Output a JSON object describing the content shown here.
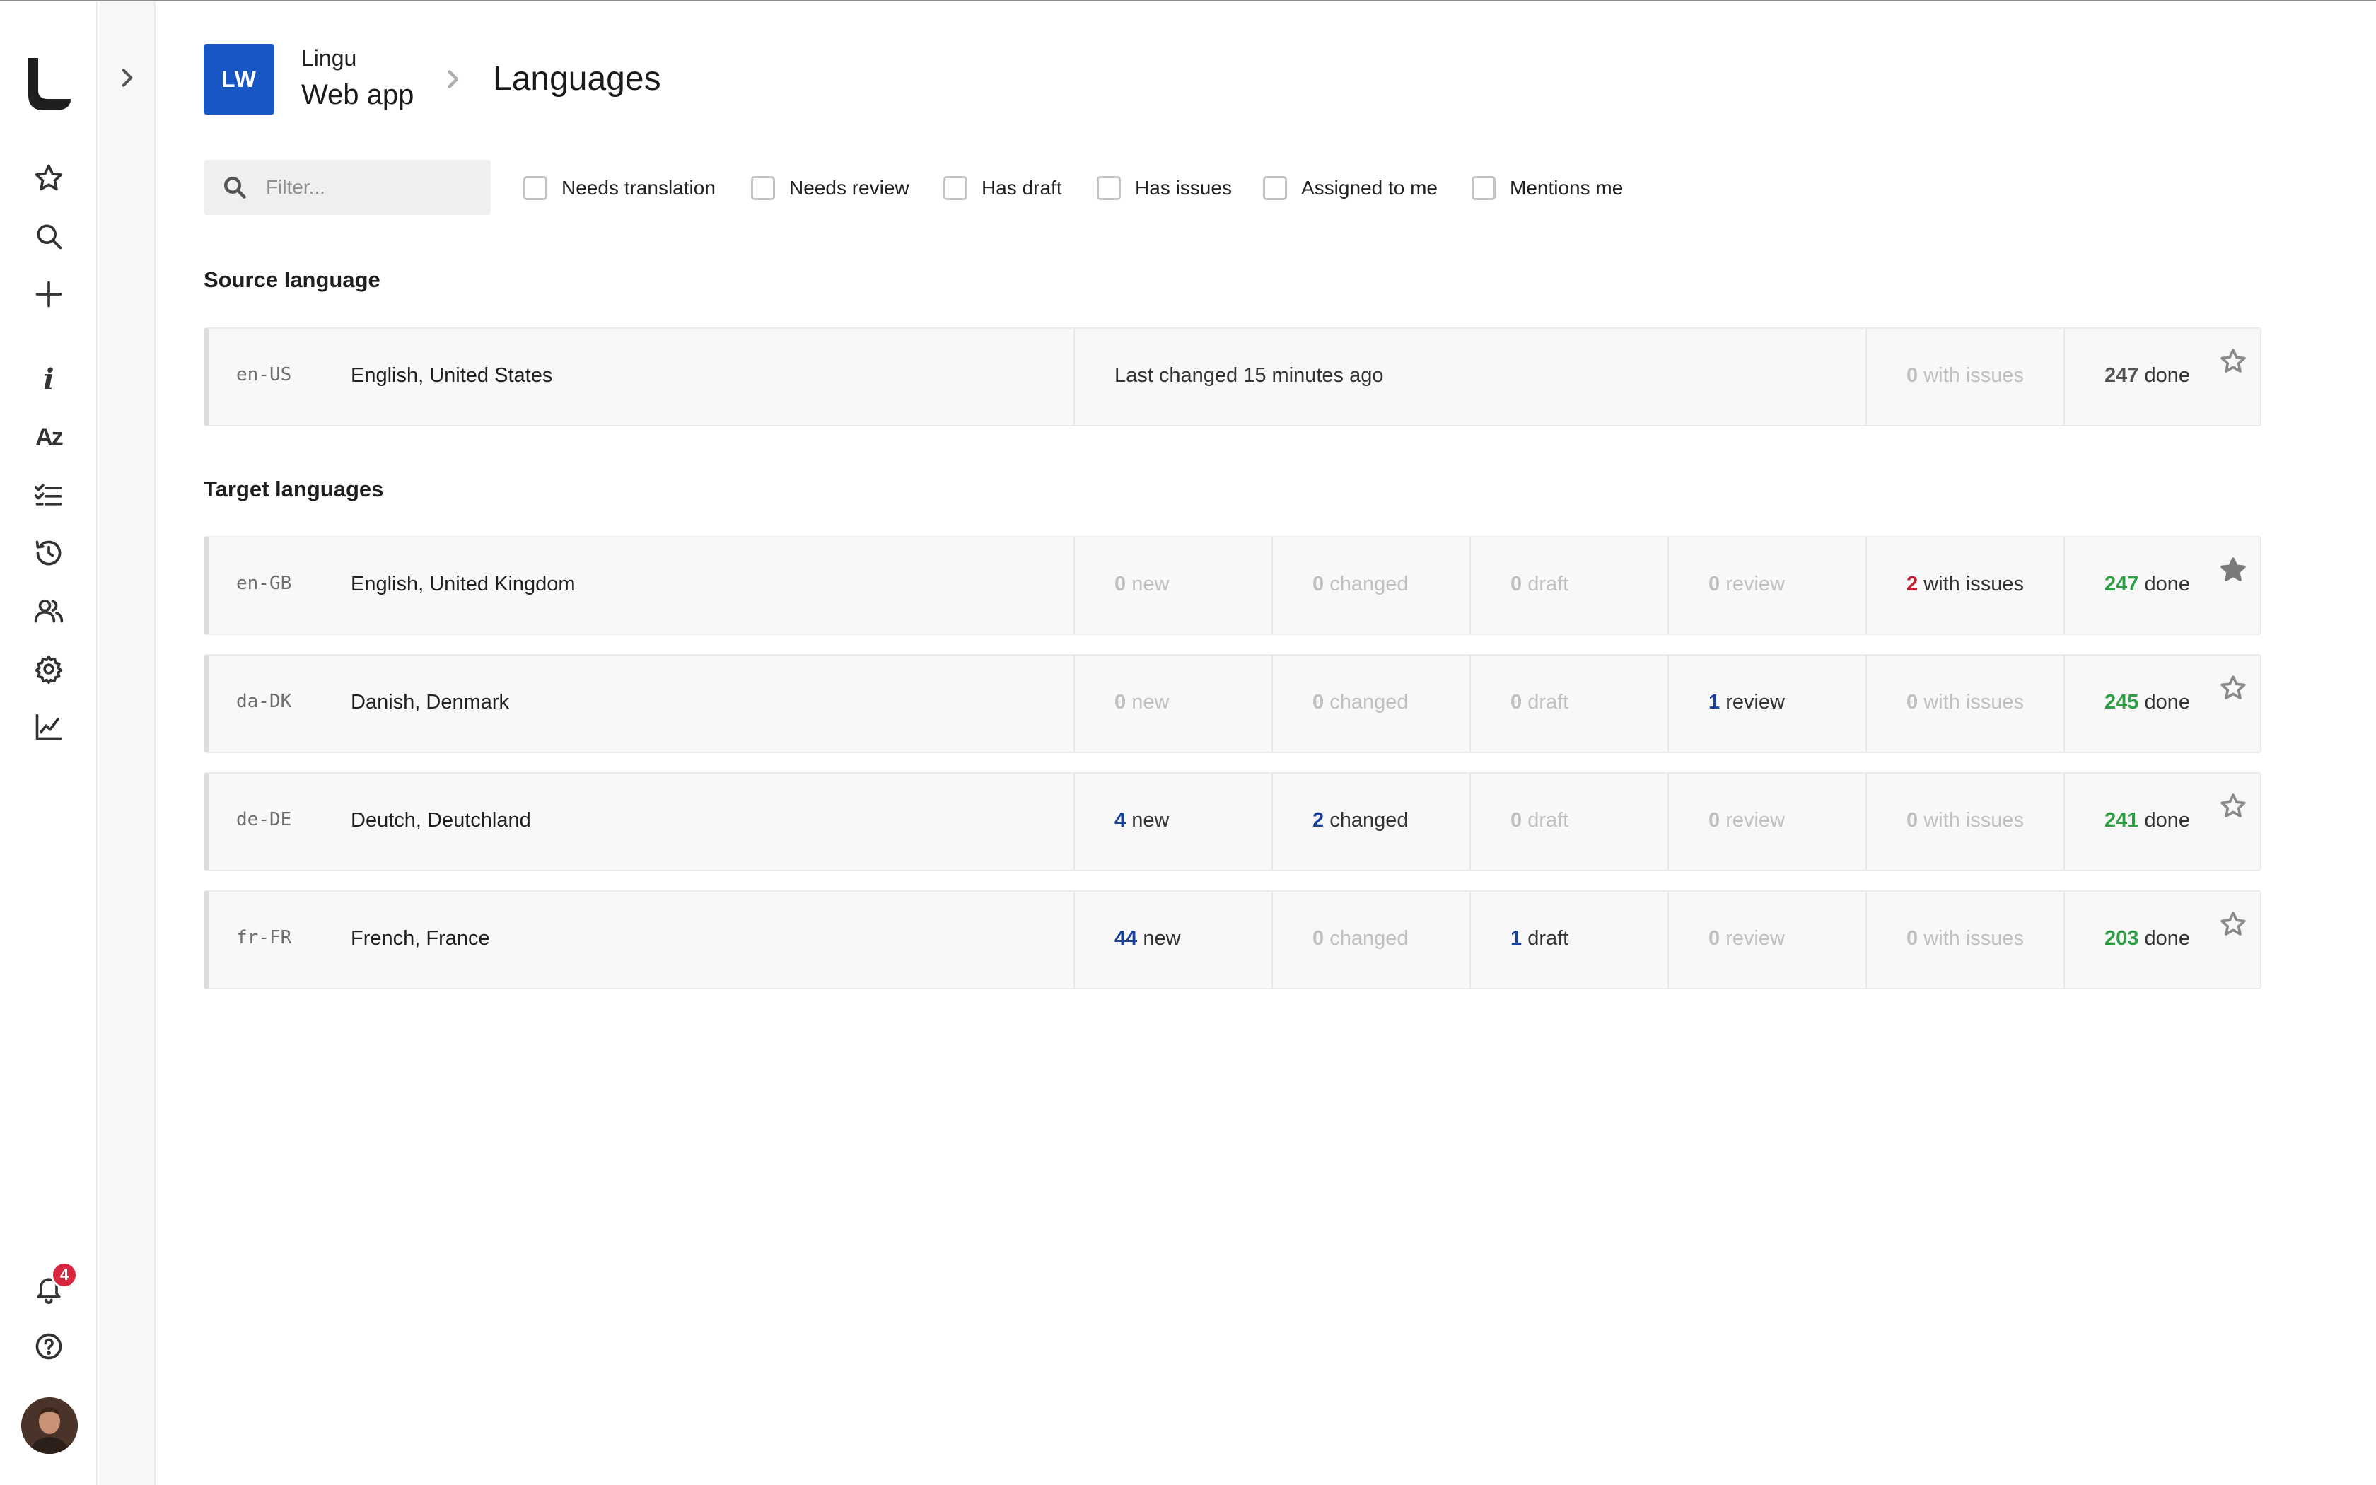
{
  "header": {
    "project_initials": "LW",
    "project_org": "Lingu",
    "project_name": "Web app",
    "page_title": "Languages"
  },
  "filter": {
    "placeholder": "Filter..."
  },
  "checkboxes": [
    {
      "label": "Needs translation",
      "checked": false
    },
    {
      "label": "Needs review",
      "checked": false
    },
    {
      "label": "Has draft",
      "checked": false
    },
    {
      "label": "Has issues",
      "checked": false
    },
    {
      "label": "Assigned to me",
      "checked": false
    },
    {
      "label": "Mentions me",
      "checked": false
    }
  ],
  "notifications": {
    "count": "4"
  },
  "source": {
    "section_title": "Source language",
    "code": "en-US",
    "name": "English, United States",
    "last_changed": "Last changed 15 minutes ago",
    "issues_num": "0",
    "issues_label": "with issues",
    "done_num": "247",
    "done_label": "done",
    "starred": false
  },
  "target": {
    "section_title": "Target languages",
    "rows": [
      {
        "code": "en-GB",
        "name": "English, United Kingdom",
        "new_num": "0",
        "new_label": "new",
        "changed_num": "0",
        "changed_label": "changed",
        "draft_num": "0",
        "draft_label": "draft",
        "review_num": "0",
        "review_label": "review",
        "issues_num": "2",
        "issues_label": "with issues",
        "done_num": "247",
        "done_label": "done",
        "starred": true
      },
      {
        "code": "da-DK",
        "name": "Danish, Denmark",
        "new_num": "0",
        "new_label": "new",
        "changed_num": "0",
        "changed_label": "changed",
        "draft_num": "0",
        "draft_label": "draft",
        "review_num": "1",
        "review_label": "review",
        "issues_num": "0",
        "issues_label": "with issues",
        "done_num": "245",
        "done_label": "done",
        "starred": false
      },
      {
        "code": "de-DE",
        "name": "Deutch, Deutchland",
        "new_num": "4",
        "new_label": "new",
        "changed_num": "2",
        "changed_label": "changed",
        "draft_num": "0",
        "draft_label": "draft",
        "review_num": "0",
        "review_label": "review",
        "issues_num": "0",
        "issues_label": "with issues",
        "done_num": "241",
        "done_label": "done",
        "starred": false
      },
      {
        "code": "fr-FR",
        "name": "French, France",
        "new_num": "44",
        "new_label": "new",
        "changed_num": "0",
        "changed_label": "changed",
        "draft_num": "1",
        "draft_label": "draft",
        "review_num": "0",
        "review_label": "review",
        "issues_num": "0",
        "issues_label": "with issues",
        "done_num": "203",
        "done_label": "done",
        "starred": false
      }
    ]
  },
  "icons": {
    "rail": [
      "star-icon",
      "search-icon",
      "plus-icon",
      "info-icon",
      "text-az-icon",
      "checklist-icon",
      "history-icon",
      "users-icon",
      "gear-icon",
      "chart-icon"
    ],
    "bottom": [
      "bell-icon",
      "help-icon"
    ]
  },
  "colors": {
    "brand": "#1756c4",
    "accent_blue": "#1a3f96",
    "issue_red": "#c11f2f",
    "done_green": "#2e9e44",
    "badge_red": "#d7263d"
  }
}
